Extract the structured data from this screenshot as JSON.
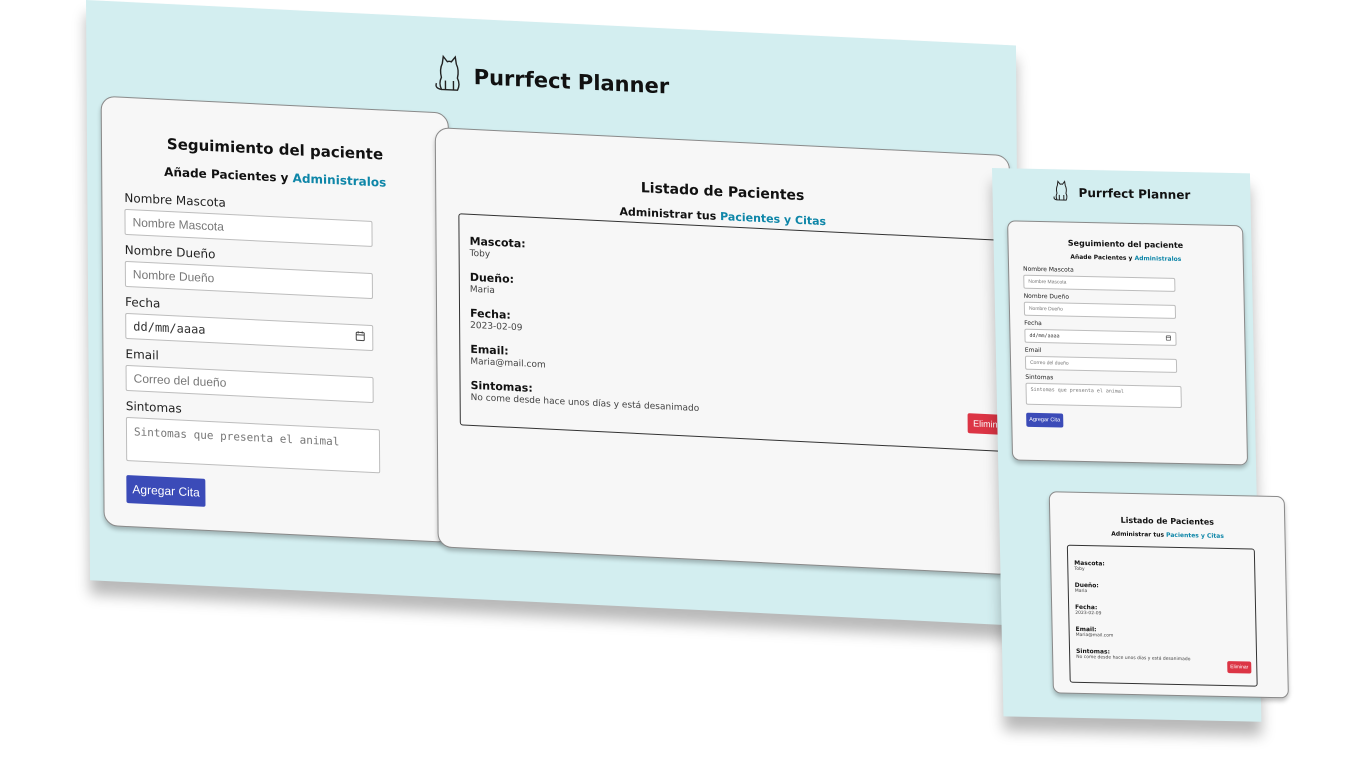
{
  "brand": {
    "title": "Purrfect Planner"
  },
  "form": {
    "title": "Seguimiento del paciente",
    "subtitle_prefix": "Añade Pacientes y ",
    "subtitle_accent": "Administralos",
    "pet_label": "Nombre Mascota",
    "pet_placeholder": "Nombre Mascota",
    "owner_label": "Nombre Dueño",
    "owner_placeholder": "Nombre Dueño",
    "date_label": "Fecha",
    "date_placeholder": "dd/mm/aaaa",
    "email_label": "Email",
    "email_placeholder": "Correo del dueño",
    "symptoms_label": "Sintomas",
    "symptoms_placeholder": "Sintomas que presenta el animal",
    "submit_label": "Agregar Cita"
  },
  "list": {
    "title": "Listado de Pacientes",
    "subtitle_prefix": "Administrar tus ",
    "subtitle_accent": "Pacientes y Citas",
    "patient": {
      "pet_label": "Mascota:",
      "pet": "Toby",
      "owner_label": "Dueño:",
      "owner": "Maria",
      "date_label": "Fecha:",
      "date": "2023-02-09",
      "email_label": "Email:",
      "email": "Maria@mail.com",
      "symptoms_label": "Sintomas:",
      "symptoms": "No come desde hace unos días y está desanimado",
      "delete_label": "Eliminar"
    }
  },
  "colors": {
    "app_background": "#d3eef0",
    "card_background": "#f7f7f7",
    "accent": "#0e86a8",
    "primary_button": "#3b4bb8",
    "danger_button": "#dc3545"
  },
  "icons": {
    "brand": "cat-icon",
    "date": "calendar-icon"
  }
}
